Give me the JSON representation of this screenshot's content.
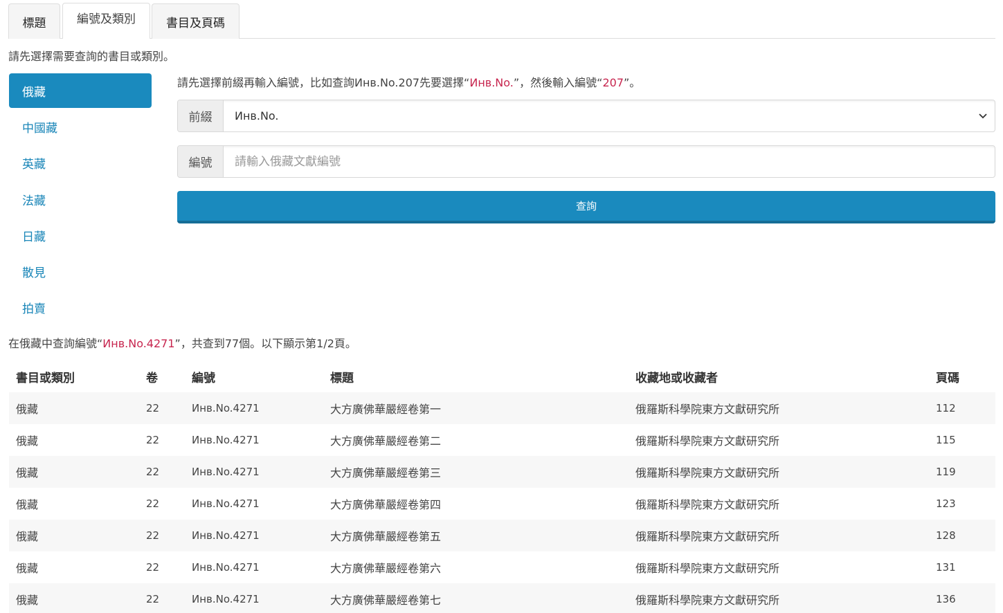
{
  "tabs": [
    {
      "label": "標題"
    },
    {
      "label": "編號及類別"
    },
    {
      "label": "書目及頁碼"
    }
  ],
  "hint": "請先選擇需要查詢的書目或類別。",
  "sidebar": {
    "items": [
      {
        "label": "俄藏"
      },
      {
        "label": "中國藏"
      },
      {
        "label": "英藏"
      },
      {
        "label": "法藏"
      },
      {
        "label": "日藏"
      },
      {
        "label": "散見"
      },
      {
        "label": "拍賣"
      }
    ]
  },
  "form": {
    "instruction": {
      "p1": "請先選擇前綴再輸入編號，比如查詢Инв.No.207先要選擇“",
      "prefix_example": "Инв.No.",
      "p2": "”，然後輸入編號“",
      "number_example": "207",
      "p3": "”。"
    },
    "prefix_label": "前綴",
    "prefix_value": "Инв.No.",
    "number_label": "編號",
    "number_placeholder": "請輸入俄藏文獻編號",
    "submit_label": "查詢"
  },
  "results": {
    "summary": {
      "p1": "在俄藏中查詢編號“",
      "query": "Инв.No.4271",
      "p2": "”，共查到77個。以下顯示第1/2頁。"
    },
    "headers": [
      "書目或類別",
      "卷",
      "編號",
      "標題",
      "收藏地或收藏者",
      "頁碼"
    ],
    "rows": [
      [
        "俄藏",
        "22",
        "Инв.No.4271",
        "大方廣佛華嚴經卷第一",
        "俄羅斯科學院東方文獻研究所",
        "112"
      ],
      [
        "俄藏",
        "22",
        "Инв.No.4271",
        "大方廣佛華嚴經卷第二",
        "俄羅斯科學院東方文獻研究所",
        "115"
      ],
      [
        "俄藏",
        "22",
        "Инв.No.4271",
        "大方廣佛華嚴經卷第三",
        "俄羅斯科學院東方文獻研究所",
        "119"
      ],
      [
        "俄藏",
        "22",
        "Инв.No.4271",
        "大方廣佛華嚴經卷第四",
        "俄羅斯科學院東方文獻研究所",
        "123"
      ],
      [
        "俄藏",
        "22",
        "Инв.No.4271",
        "大方廣佛華嚴經卷第五",
        "俄羅斯科學院東方文獻研究所",
        "128"
      ],
      [
        "俄藏",
        "22",
        "Инв.No.4271",
        "大方廣佛華嚴經卷第六",
        "俄羅斯科學院東方文獻研究所",
        "131"
      ],
      [
        "俄藏",
        "22",
        "Инв.No.4271",
        "大方廣佛華嚴經卷第七",
        "俄羅斯科學院東方文獻研究所",
        "136"
      ]
    ]
  },
  "colors": {
    "accent": "#1a8abe",
    "link": "#1a86b8",
    "highlight": "#c7254e"
  },
  "icons": {
    "select_caret": "chevron-down-icon"
  }
}
